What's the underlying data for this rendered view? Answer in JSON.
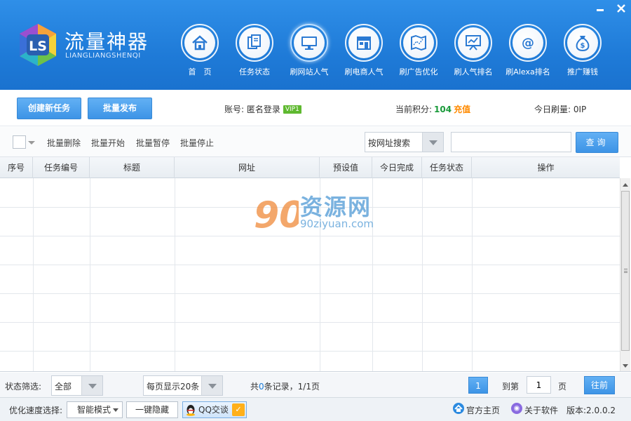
{
  "header": {
    "brand_name": "流量神器",
    "brand_sub": "LIANGLIANGSHENQI",
    "nav": [
      {
        "label": "首　页",
        "icon": "home-icon"
      },
      {
        "label": "任务状态",
        "icon": "documents-icon"
      },
      {
        "label": "刷网站人气",
        "icon": "monitor-icon"
      },
      {
        "label": "刷电商人气",
        "icon": "shop-icon"
      },
      {
        "label": "刷广告优化",
        "icon": "map-chart-icon"
      },
      {
        "label": "刷人气排名",
        "icon": "presentation-chart-icon"
      },
      {
        "label": "刷Alexa排名",
        "icon": "at-icon"
      },
      {
        "label": "推广赚钱",
        "icon": "money-bag-icon"
      }
    ],
    "active_nav": "刷网站人气"
  },
  "actionbar": {
    "create_label": "创建新任务",
    "batch_publish_label": "批量发布",
    "account_label": "账号: 匿名登录",
    "vip_badge": "VIP1",
    "points_label": "当前积分:",
    "points_value": "104",
    "recharge_label": "充值",
    "today_label": "今日刷量: 0IP"
  },
  "toolbar": {
    "batch_delete": "批量删除",
    "batch_start": "批量开始",
    "batch_pause": "批量暂停",
    "batch_stop": "批量停止",
    "search_type": "按网址搜索",
    "search_value": "",
    "query_label": "查询"
  },
  "table": {
    "columns": [
      "序号",
      "任务编号",
      "标题",
      "网址",
      "预设值",
      "今日完成",
      "任务状态",
      "操作"
    ],
    "rows": []
  },
  "watermark": {
    "text": "资源网",
    "sub": "90ziyuan.com"
  },
  "pager": {
    "filter_label": "状态筛选:",
    "filter_value": "全部",
    "per_page": "每页显示20条",
    "record_prefix": "共",
    "record_count": "0",
    "record_suffix": "条记录，1/1页",
    "current_page": "1",
    "goto_label": "到第",
    "goto_value": "1",
    "page_unit": "页",
    "go_label": "往前"
  },
  "statusbar": {
    "speed_label": "优化速度选择:",
    "mode": "智能模式",
    "hide_label": "一键隐藏",
    "qq_label": "QQ交谈",
    "homepage": "官方主页",
    "about": "关于软件",
    "version": "版本:2.0.0.2"
  },
  "colors": {
    "header": "#2384dc",
    "accent": "#3d94e6",
    "points": "#1a9a3a",
    "recharge": "#ff8a00",
    "vip": "#5fb930"
  }
}
